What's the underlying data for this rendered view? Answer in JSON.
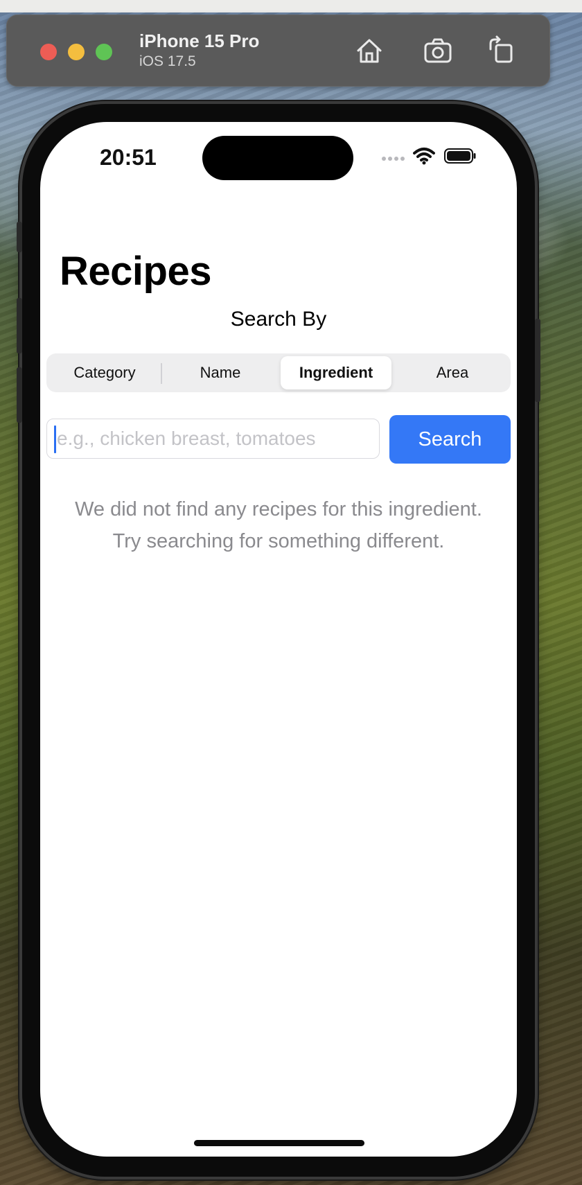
{
  "simulator": {
    "device_name": "iPhone 15 Pro",
    "os_version": "iOS 17.5",
    "toolbar_icons": [
      "home-icon",
      "screenshot-icon",
      "rotate-icon"
    ]
  },
  "status_bar": {
    "time": "20:51"
  },
  "page": {
    "title": "Recipes",
    "search_by_label": "Search By"
  },
  "segmented_control": {
    "selected": "Ingredient",
    "options": [
      "Category",
      "Name",
      "Ingredient",
      "Area"
    ]
  },
  "search": {
    "placeholder": "e.g., chicken breast, tomatoes",
    "value": "",
    "button_label": "Search"
  },
  "empty_state": {
    "line1": "We did not find any recipes for this ingredient.",
    "line2": "Try searching for something different."
  },
  "colors": {
    "accent": "#3478f6",
    "close": "#ed5d55",
    "minimize": "#f4be3f",
    "zoom": "#5fc455"
  }
}
